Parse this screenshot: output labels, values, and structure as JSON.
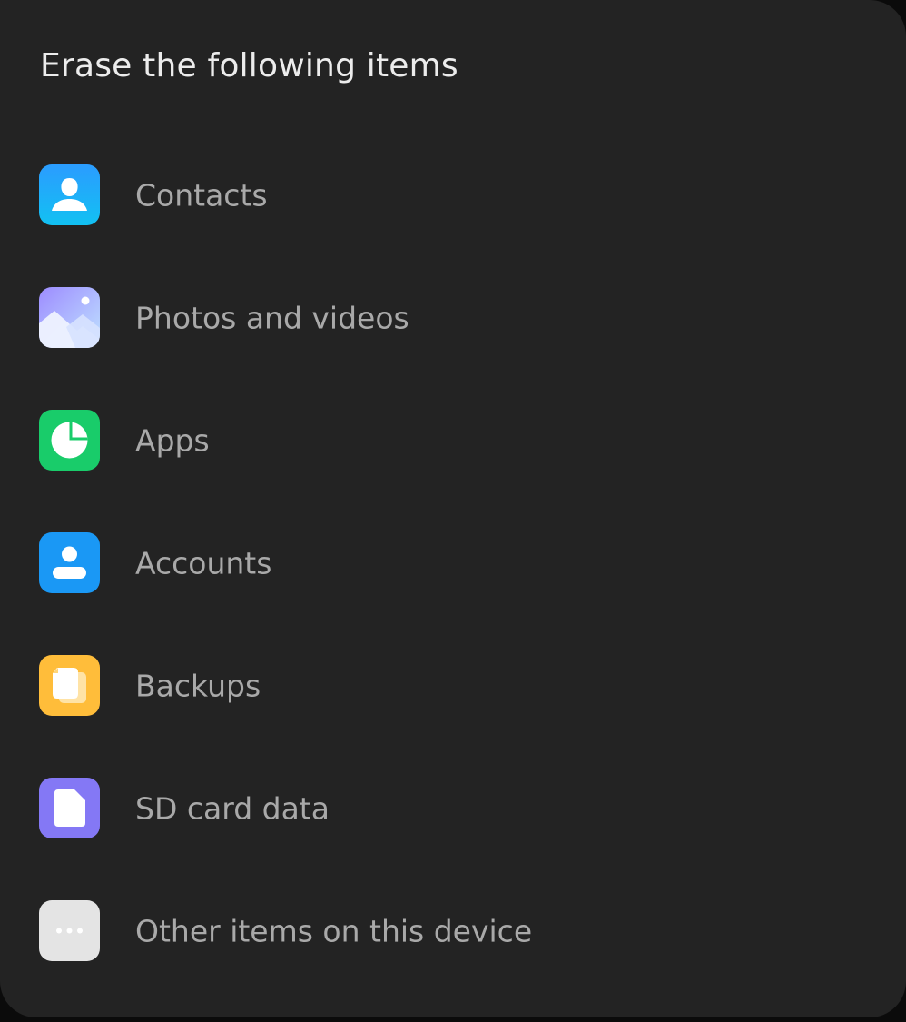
{
  "dialog": {
    "title": "Erase the following items"
  },
  "items": [
    {
      "label": "Contacts",
      "icon": "contacts-icon",
      "color": "#1aa3ff"
    },
    {
      "label": "Photos and videos",
      "icon": "gallery-icon",
      "color": "#a9b6ff"
    },
    {
      "label": "Apps",
      "icon": "apps-pie-icon",
      "color": "#19cc6a"
    },
    {
      "label": "Accounts",
      "icon": "account-icon",
      "color": "#1a98f5"
    },
    {
      "label": "Backups",
      "icon": "backup-icon",
      "color": "#ffbd3a"
    },
    {
      "label": "SD card data",
      "icon": "document-icon",
      "color": "#8478f5"
    },
    {
      "label": "Other items on this device",
      "icon": "more-dots-icon",
      "color": "#e4e4e4"
    }
  ]
}
